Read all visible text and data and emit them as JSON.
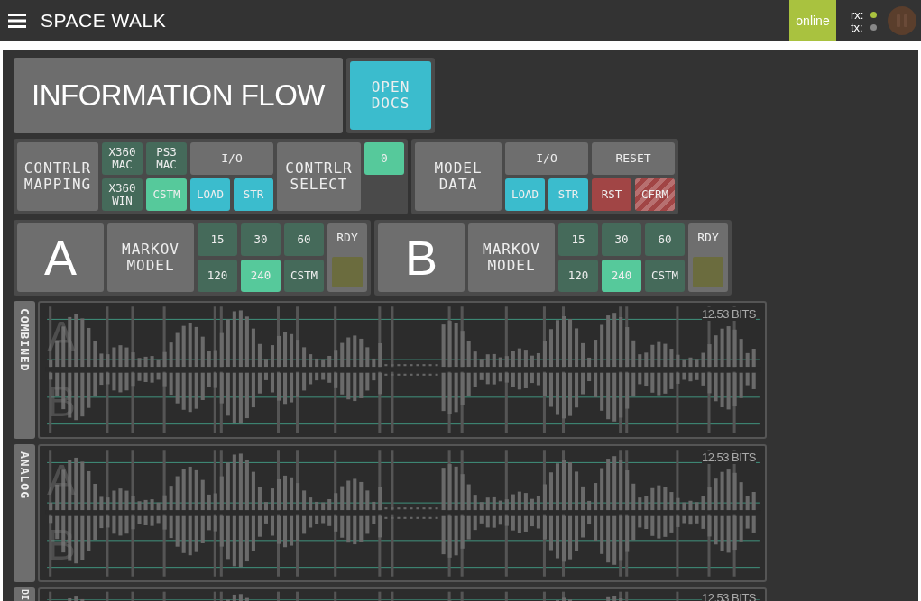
{
  "header": {
    "title": "SPACE WALK",
    "status": "online",
    "rx": {
      "label": "rx:",
      "active": true
    },
    "tx": {
      "label": "tx:",
      "active": false
    }
  },
  "info": {
    "title": "INFORMATION FLOW",
    "docs_button": "OPEN DOCS"
  },
  "controller": {
    "mapping_label": "CONTRLR MAPPING",
    "presets": [
      {
        "label": "X360 MAC",
        "selected": false
      },
      {
        "label": "PS3 MAC",
        "selected": false
      },
      {
        "label": "X360 WIN",
        "selected": false
      },
      {
        "label": "CSTM",
        "selected": true
      }
    ],
    "io": {
      "label": "I/O",
      "buttons": [
        "LOAD",
        "STR"
      ]
    },
    "select_label": "CONTRLR SELECT",
    "select_value": "0"
  },
  "model_data": {
    "label": "MODEL DATA",
    "io": {
      "label": "I/O",
      "buttons": [
        "LOAD",
        "STR"
      ]
    },
    "reset": {
      "label": "RESET",
      "buttons": [
        {
          "label": "RST",
          "kind": "reset"
        },
        {
          "label": "CFRM",
          "kind": "confirm"
        }
      ]
    }
  },
  "models": [
    {
      "name": "A",
      "label": "MARKOV MODEL",
      "orders": [
        {
          "label": "15",
          "selected": false
        },
        {
          "label": "30",
          "selected": false
        },
        {
          "label": "60",
          "selected": false
        },
        {
          "label": "120",
          "selected": false
        },
        {
          "label": "240",
          "selected": true
        },
        {
          "label": "CSTM",
          "selected": false
        }
      ],
      "ready": {
        "label": "RDY",
        "on": false
      }
    },
    {
      "name": "B",
      "label": "MARKOV MODEL",
      "orders": [
        {
          "label": "15",
          "selected": false
        },
        {
          "label": "30",
          "selected": false
        },
        {
          "label": "60",
          "selected": false
        },
        {
          "label": "120",
          "selected": false
        },
        {
          "label": "240",
          "selected": true
        },
        {
          "label": "CSTM",
          "selected": false
        }
      ],
      "ready": {
        "label": "RDY",
        "on": false
      }
    }
  ],
  "charts": [
    {
      "label": "COMBINED",
      "bits": "12.53 BITS",
      "letters": [
        "A",
        "B"
      ]
    },
    {
      "label": "ANALOG",
      "bits": "12.53 BITS",
      "letters": [
        "A",
        "B"
      ]
    },
    {
      "label": "DI",
      "bits": "12.53 BITS"
    }
  ]
}
